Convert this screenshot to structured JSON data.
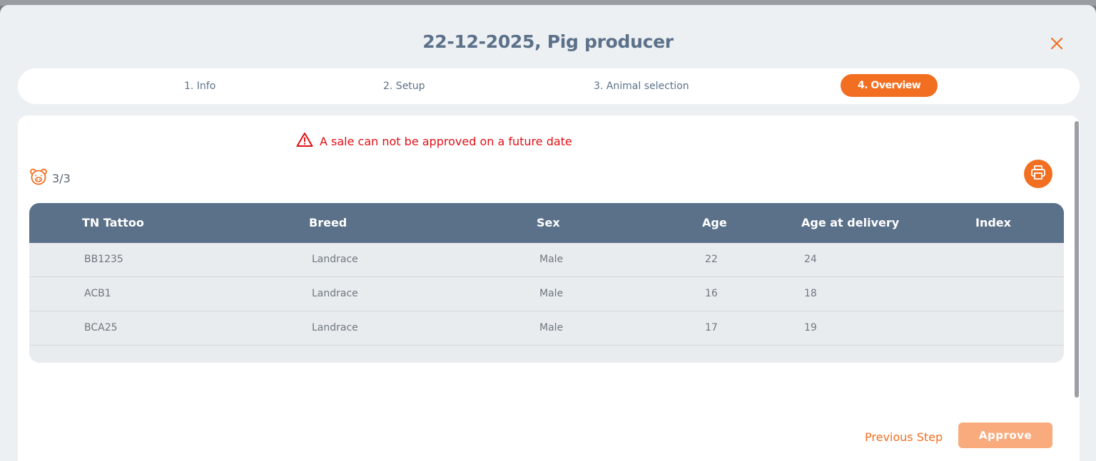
{
  "dialog": {
    "title": "22-12-2025, Pig producer",
    "close_icon": "close-icon"
  },
  "steps": [
    {
      "label": "1. Info",
      "active": false
    },
    {
      "label": "2. Setup",
      "active": false
    },
    {
      "label": "3. Animal selection",
      "active": false
    },
    {
      "label": "4. Overview",
      "active": true
    }
  ],
  "warning": {
    "icon": "warning-triangle-icon",
    "text": "A sale can not be approved on a future date"
  },
  "counter": {
    "icon": "pig-icon",
    "text": "3/3"
  },
  "print": {
    "icon": "printer-icon"
  },
  "table": {
    "columns": [
      "TN Tattoo",
      "Breed",
      "Sex",
      "Age",
      "Age at delivery",
      "Index"
    ],
    "rows": [
      [
        "BB1235",
        "Landrace",
        "Male",
        "22",
        "24",
        ""
      ],
      [
        "ACB1",
        "Landrace",
        "Male",
        "16",
        "18",
        ""
      ],
      [
        "BCA25",
        "Landrace",
        "Male",
        "17",
        "19",
        ""
      ]
    ]
  },
  "footer": {
    "previous_label": "Previous Step",
    "approve_label": "Approve"
  },
  "colors": {
    "accent": "#f26f21",
    "accent_disabled": "#f9ab7d",
    "header": "#5b7189",
    "error": "#e00f15",
    "panel": "#edf0f3"
  }
}
